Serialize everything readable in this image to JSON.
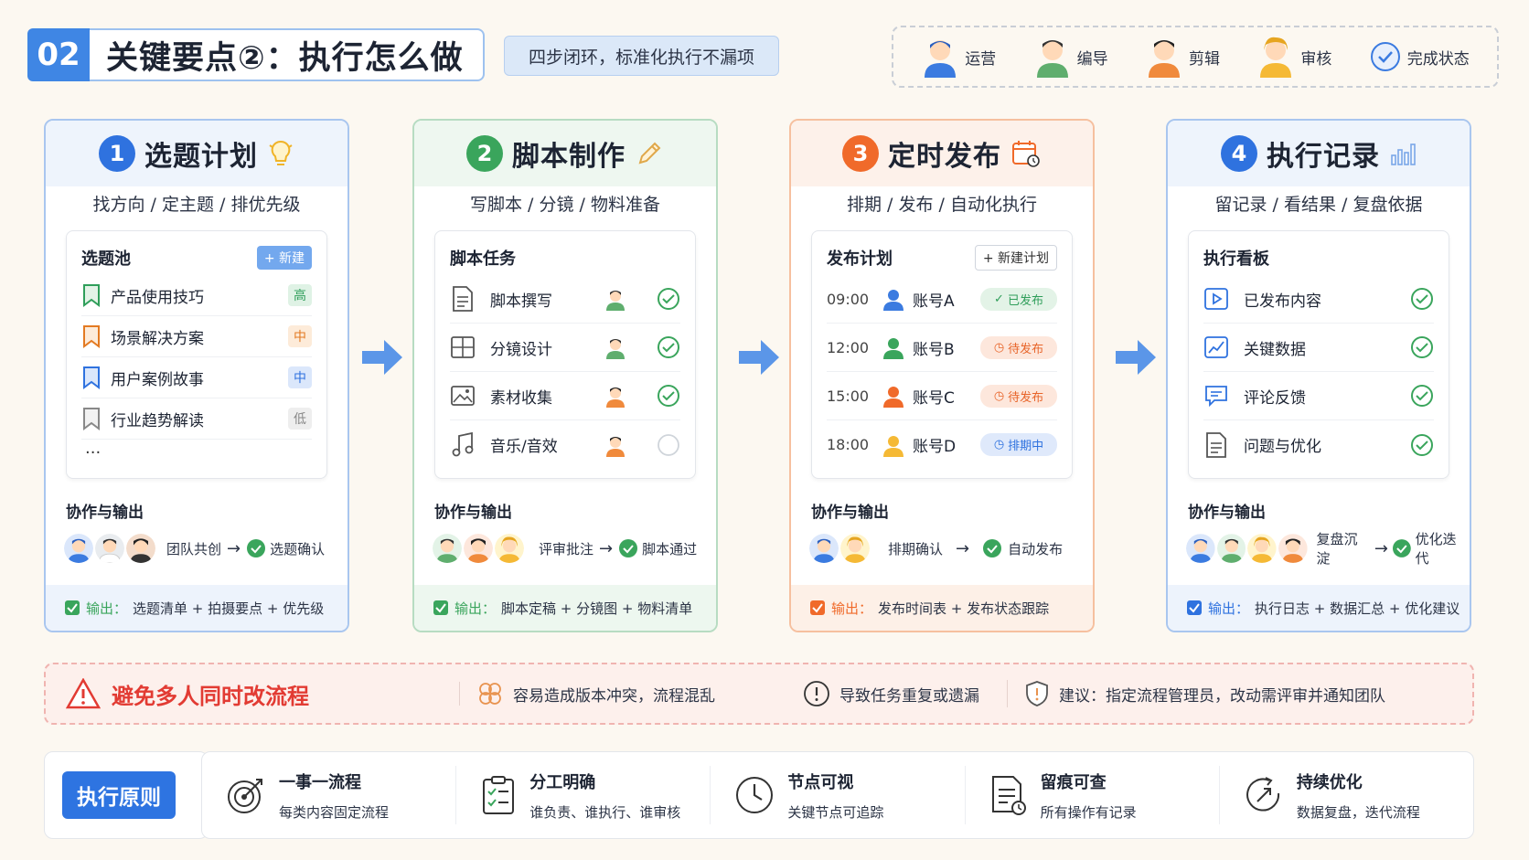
{
  "header": {
    "num": "02",
    "title": "关键要点②：执行怎么做",
    "subtitle": "四步闭环，标准化执行不漏项"
  },
  "legend": [
    {
      "label": "运营",
      "icon": "operator-avatar-icon",
      "color": "#3b7be0"
    },
    {
      "label": "编导",
      "icon": "director-avatar-icon",
      "color": "#5fae6e"
    },
    {
      "label": "剪辑",
      "icon": "editor-avatar-icon",
      "color": "#f08a3c"
    },
    {
      "label": "审核",
      "icon": "reviewer-avatar-icon",
      "color": "#f5b935"
    },
    {
      "label": "完成状态",
      "icon": "check-circle-icon",
      "color": "#3b7be0"
    }
  ],
  "steps": [
    {
      "num": "1",
      "title": "选题计划",
      "subtitle": "找方向 / 定主题 / 排优先级",
      "accent": "#2f72df",
      "panel_title": "选题池",
      "panel_btn": "+ 新建",
      "rows": [
        {
          "label": "产品使用技巧",
          "badge": "高",
          "badge_color": "#2f9e5a",
          "badge_bg": "#dff2e5",
          "icon_color": "#2f9e5a"
        },
        {
          "label": "场景解决方案",
          "badge": "中",
          "badge_color": "#e37a22",
          "badge_bg": "#fdebd9",
          "icon_color": "#e37a22"
        },
        {
          "label": "用户案例故事",
          "badge": "中",
          "badge_color": "#2f72df",
          "badge_bg": "#dbe7fb",
          "icon_color": "#2f72df"
        },
        {
          "label": "行业趋势解读",
          "badge": "低",
          "badge_color": "#888",
          "badge_bg": "#eeeeee",
          "icon_color": "#888"
        }
      ],
      "more": "...",
      "collab_title": "协作与输出",
      "collab_a": "团队共创",
      "collab_b": "选题确认",
      "output_label": "输出：",
      "output_text": "选题清单 + 拍摄要点 + 优先级"
    },
    {
      "num": "2",
      "title": "脚本制作",
      "subtitle": "写脚本 / 分镜 / 物料准备",
      "accent": "#3aa55c",
      "panel_title": "脚本任务",
      "rows": [
        {
          "label": "脚本撰写",
          "done": true
        },
        {
          "label": "分镜设计",
          "done": true
        },
        {
          "label": "素材收集",
          "done": true
        },
        {
          "label": "音乐/音效",
          "done": false
        }
      ],
      "collab_title": "协作与输出",
      "collab_a": "评审批注",
      "collab_b": "脚本通过",
      "output_label": "输出：",
      "output_text": "脚本定稿 + 分镜图 + 物料清单"
    },
    {
      "num": "3",
      "title": "定时发布",
      "subtitle": "排期 / 发布 / 自动化执行",
      "accent": "#f06a2a",
      "panel_title": "发布计划",
      "panel_btn": "+ 新建计划",
      "rows": [
        {
          "time": "09:00",
          "account": "账号A",
          "status": "已发布",
          "status_color": "#2f9e5a",
          "status_bg": "#e3f3e7"
        },
        {
          "time": "12:00",
          "account": "账号B",
          "status": "待发布",
          "status_color": "#e8652a",
          "status_bg": "#fde7dc"
        },
        {
          "time": "15:00",
          "account": "账号C",
          "status": "待发布",
          "status_color": "#e8652a",
          "status_bg": "#fde7dc"
        },
        {
          "time": "18:00",
          "account": "账号D",
          "status": "排期中",
          "status_color": "#2f72df",
          "status_bg": "#dfe9fb"
        }
      ],
      "collab_title": "协作与输出",
      "collab_a": "排期确认",
      "collab_b": "自动发布",
      "output_label": "输出：",
      "output_text": "发布时间表 + 发布状态跟踪"
    },
    {
      "num": "4",
      "title": "执行记录",
      "subtitle": "留记录 / 看结果 / 复盘依据",
      "accent": "#2f72df",
      "panel_title": "执行看板",
      "rows": [
        {
          "label": "已发布内容"
        },
        {
          "label": "关键数据"
        },
        {
          "label": "评论反馈"
        },
        {
          "label": "问题与优化"
        }
      ],
      "collab_title": "协作与输出",
      "collab_a": "复盘沉淀",
      "collab_b": "优化迭代",
      "output_label": "输出：",
      "output_text": "执行日志 + 数据汇总 + 优化建议"
    }
  ],
  "warning": {
    "title": "避免多人同时改流程",
    "items": [
      "容易造成版本冲突，流程混乱",
      "导致任务重复或遗漏",
      "建议：指定流程管理员，改动需评审并通知团队"
    ]
  },
  "principles": {
    "label": "执行原则",
    "items": [
      {
        "title": "一事一流程",
        "desc": "每类内容固定流程"
      },
      {
        "title": "分工明确",
        "desc": "谁负责、谁执行、谁审核"
      },
      {
        "title": "节点可视",
        "desc": "关键节点可追踪"
      },
      {
        "title": "留痕可查",
        "desc": "所有操作有记录"
      },
      {
        "title": "持续优化",
        "desc": "数据复盘，迭代流程"
      }
    ]
  }
}
